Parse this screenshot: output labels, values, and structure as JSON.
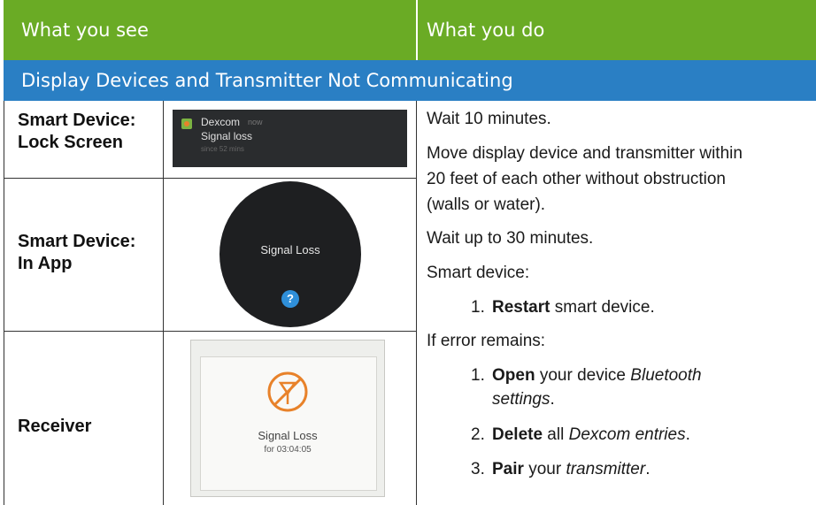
{
  "header": {
    "left": "What you see",
    "right": "What you do"
  },
  "section": {
    "title": "Display Devices and Transmitter Not Communicating"
  },
  "rows": {
    "lock_screen": {
      "label_1": "Smart Device:",
      "label_2": "Lock Screen",
      "notif_app": "Dexcom",
      "notif_time": "now",
      "notif_text": "Signal loss",
      "notif_sub": "since 52 mins"
    },
    "in_app": {
      "label_1": "Smart Device:",
      "label_2": "In App",
      "watch_text": "Signal Loss",
      "help_glyph": "?"
    },
    "receiver": {
      "label": "Receiver",
      "screen_text": "Signal Loss",
      "screen_sub": "for 03:04:05"
    }
  },
  "instructions": {
    "wait10": "Wait 10 minutes.",
    "move_1": "Move display device and transmitter within",
    "move_2": "20 feet of each other without obstruction",
    "move_3": "(walls or water).",
    "wait30": "Wait up to 30 minutes.",
    "smart_device": "Smart device:",
    "step_restart": {
      "num": "1.",
      "bold": "Restart",
      "rest": " smart device."
    },
    "if_error": "If error remains:",
    "step_open": {
      "num": "1.",
      "bold": "Open",
      "rest": " your device ",
      "ital_1": "Bluetooth",
      "ital_2": "settings",
      "end": "."
    },
    "step_delete": {
      "num": "2.",
      "bold": "Delete",
      "rest": " all ",
      "ital": "Dexcom entries",
      "end": "."
    },
    "step_pair": {
      "num": "3.",
      "bold": "Pair",
      "rest": " your ",
      "ital": "transmitter",
      "end": "."
    }
  },
  "colors": {
    "header_green": "#6aab25",
    "section_blue": "#2a7fc4",
    "signal_orange": "#e8822a",
    "help_blue": "#2f8fd9"
  }
}
